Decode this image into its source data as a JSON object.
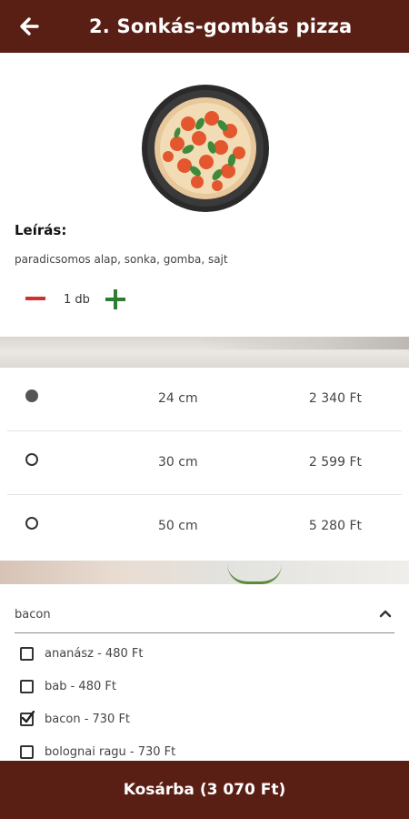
{
  "header": {
    "title": "2. Sonkás-gombás pizza",
    "back_icon": "arrow-left-icon",
    "background": "#5a1f14"
  },
  "product": {
    "image_icon": "pizza-image",
    "description_title": "Leírás:",
    "description": "paradicsomos alap, sonka, gomba, sajt",
    "quantity_label": "1 db",
    "minus_icon": "minus-icon",
    "plus_icon": "plus-icon",
    "minus_color": "#d32f2f",
    "plus_color": "#2e7d32"
  },
  "sizes": [
    {
      "size": "24 cm",
      "price": "2 340 Ft",
      "selected": true
    },
    {
      "size": "30 cm",
      "price": "2 599 Ft",
      "selected": false
    },
    {
      "size": "50 cm",
      "price": "5 280 Ft",
      "selected": false
    }
  ],
  "extras": {
    "dropdown_value": "bacon",
    "dropdown_icon": "chevron-up-icon",
    "options": [
      {
        "label": "ananász - 480 Ft",
        "checked": false
      },
      {
        "label": "bab - 480 Ft",
        "checked": false
      },
      {
        "label": "bacon - 730 Ft",
        "checked": true
      },
      {
        "label": "bolognai ragu - 730 Ft",
        "checked": false
      }
    ]
  },
  "footer": {
    "cart_label": "Kosárba (3 070 Ft)",
    "background": "#5a1f14"
  }
}
